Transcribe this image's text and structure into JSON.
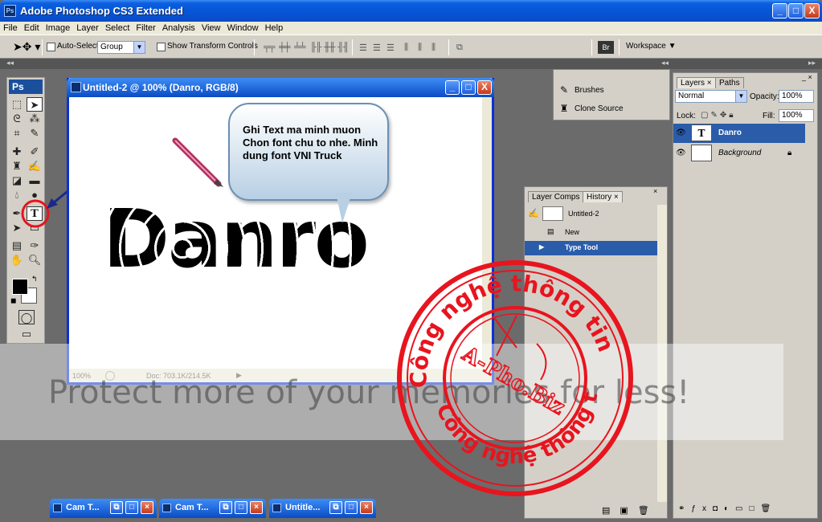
{
  "window": {
    "title": "Adobe Photoshop CS3 Extended",
    "minimize": "_",
    "maximize": "□",
    "close": "X"
  },
  "menu": [
    "File",
    "Edit",
    "Image",
    "Layer",
    "Select",
    "Filter",
    "Analysis",
    "View",
    "Window",
    "Help"
  ],
  "options": {
    "auto_select_label": "Auto-Select:",
    "auto_select_value": "Group",
    "show_transform_label": "Show Transform Controls",
    "workspace_label": "Workspace ▼"
  },
  "toolbox": {
    "logo": "Ps"
  },
  "document": {
    "title": "Untitled-2 @ 100% (Danro, RGB/8)",
    "canvas_text": "Danro",
    "zoom": "100%",
    "doc_size": "Doc: 703.1K/214.5K"
  },
  "bubble": {
    "text": "Ghi Text ma minh muon Chon font chu to nhe. Minh dung font VNI Truck"
  },
  "brush_panel": {
    "brushes": "Brushes",
    "clone_source": "Clone Source"
  },
  "layers_panel": {
    "tab_layers": "Layers",
    "tab_paths": "Paths",
    "blend_mode": "Normal",
    "opacity_label": "Opacity:",
    "opacity_value": "100%",
    "lock_label": "Lock:",
    "fill_label": "Fill:",
    "fill_value": "100%",
    "layers": [
      {
        "name": "Danro",
        "thumb": "T"
      },
      {
        "name": "Background",
        "thumb": ""
      }
    ]
  },
  "history_panel": {
    "tab_layer_comps": "Layer Comps",
    "tab_history": "History",
    "snapshot": "Untitled-2",
    "items": [
      "New",
      "Type Tool"
    ]
  },
  "watermark": {
    "text": "Protect more of your memories for less!"
  },
  "stamp": {
    "top_text": "Công nghệ thông tin",
    "bottom_text": "Công nghệ thông tin",
    "center_text": "A-Pho.Biz"
  },
  "taskbar": [
    {
      "title": "Cam T..."
    },
    {
      "title": "Cam T..."
    },
    {
      "title": "Untitle..."
    }
  ],
  "colors": {
    "xp_blue": "#0a5fe0",
    "stamp_red": "#e8141e",
    "selection": "#2a5caa"
  }
}
